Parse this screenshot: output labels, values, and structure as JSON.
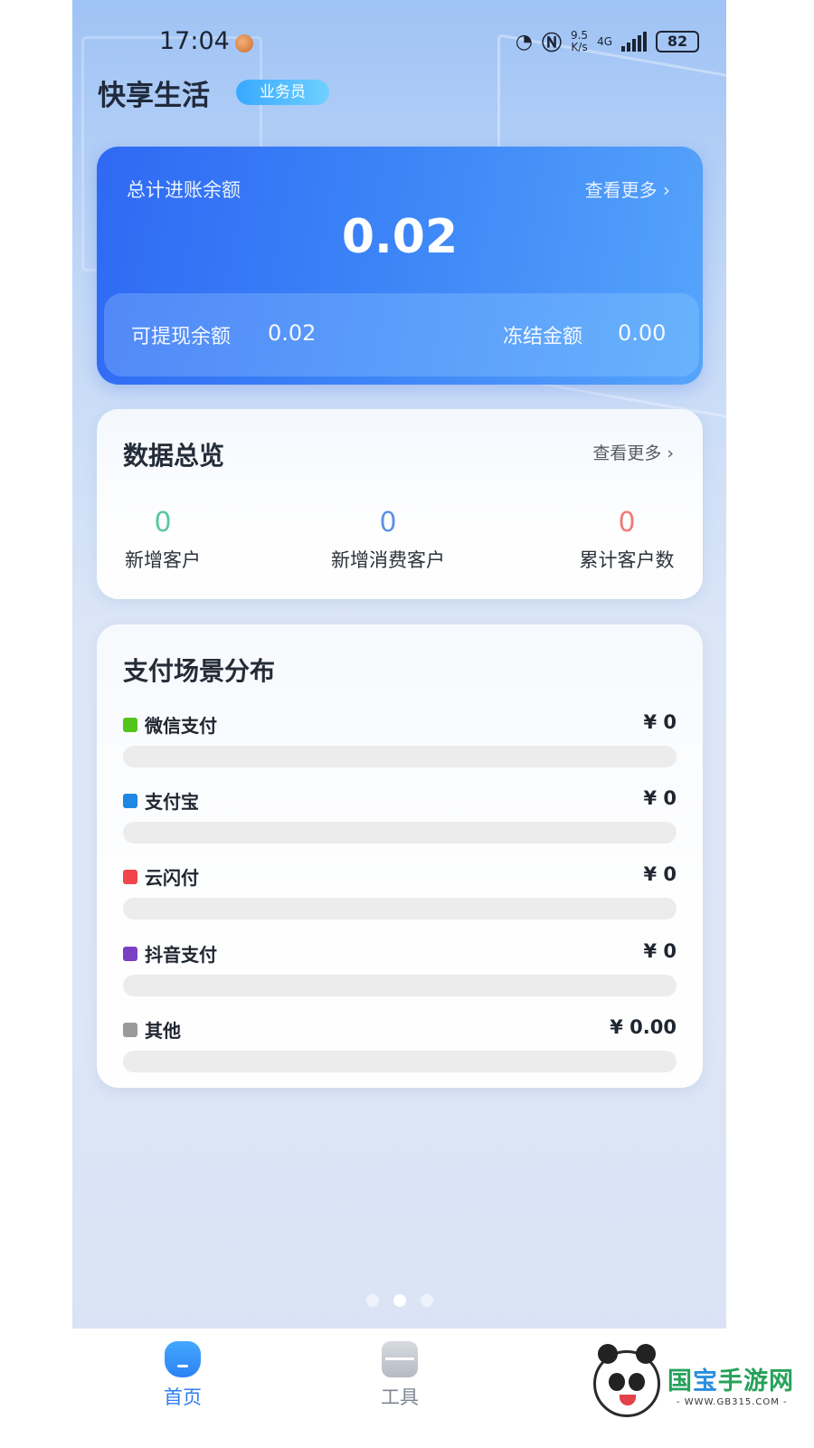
{
  "status_bar": {
    "time": "17:04",
    "network_speed_value": "9.5",
    "network_speed_unit": "K/s",
    "network_type": "4G",
    "battery": "82"
  },
  "header": {
    "app_title": "快享生活",
    "role_badge": "业务员"
  },
  "balance_card": {
    "label": "总计进账余额",
    "more": "查看更多 ›",
    "total": "0.02",
    "withdrawable_label": "可提现余额",
    "withdrawable_value": "0.02",
    "frozen_label": "冻结金额",
    "frozen_value": "0.00"
  },
  "overview": {
    "title": "数据总览",
    "more": "查看更多 ›",
    "stats": [
      {
        "value": "0",
        "label": "新增客户",
        "color": "#5cc79b"
      },
      {
        "value": "0",
        "label": "新增消费客户",
        "color": "#5d92e8"
      },
      {
        "value": "0",
        "label": "累计客户数",
        "color": "#f07a78"
      }
    ]
  },
  "payments": {
    "title": "支付场景分布",
    "items": [
      {
        "name": "微信支付",
        "amount": "¥ 0",
        "color": "#52c41a",
        "share": 0
      },
      {
        "name": "支付宝",
        "amount": "¥ 0",
        "color": "#1e88e5",
        "share": 0
      },
      {
        "name": "云闪付",
        "amount": "¥ 0",
        "color": "#f0464a",
        "share": 0
      },
      {
        "name": "抖音支付",
        "amount": "¥ 0",
        "color": "#7b3fc4",
        "share": 0
      },
      {
        "name": "其他",
        "amount": "¥ 0.00",
        "color": "#9a9a9a",
        "share": 0
      }
    ]
  },
  "pager": {
    "count": 3,
    "active": 1
  },
  "tabbar": {
    "home": "首页",
    "tools": "工具"
  },
  "watermark": {
    "text_a": "国",
    "text_b": "宝",
    "text_c": "手游网",
    "url": "- WWW.GB315.COM -"
  }
}
